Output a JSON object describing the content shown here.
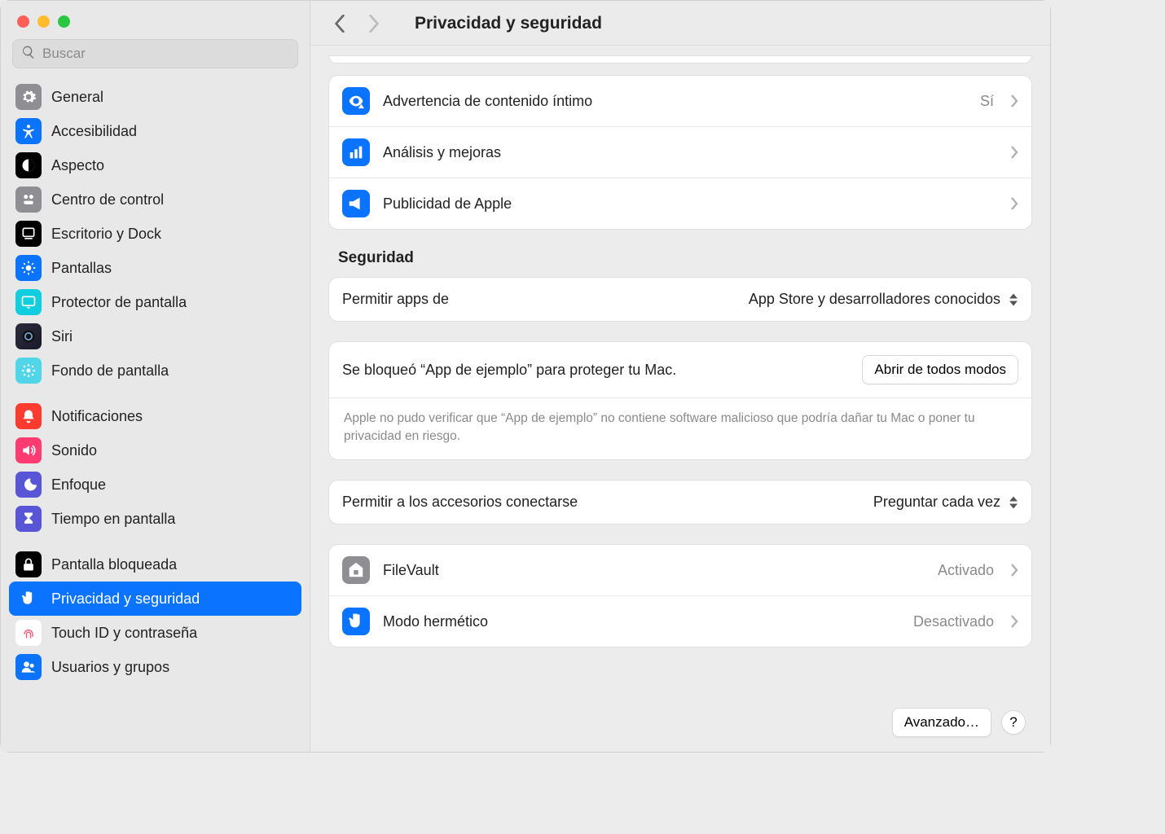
{
  "search": {
    "placeholder": "Buscar"
  },
  "sidebar": {
    "items": [
      {
        "label": "General",
        "icon": "gear",
        "bg": "#8e8e93"
      },
      {
        "label": "Accesibilidad",
        "icon": "access",
        "bg": "#0a73ff"
      },
      {
        "label": "Aspecto",
        "icon": "aspect",
        "bg": "#000000"
      },
      {
        "label": "Centro de control",
        "icon": "control",
        "bg": "#8e8e93"
      },
      {
        "label": "Escritorio y Dock",
        "icon": "dock",
        "bg": "#000000"
      },
      {
        "label": "Pantallas",
        "icon": "displays",
        "bg": "#0a73ff"
      },
      {
        "label": "Protector de pantalla",
        "icon": "screensaver",
        "bg": "#11cde0"
      },
      {
        "label": "Siri",
        "icon": "siri",
        "bg": "grad-siri"
      },
      {
        "label": "Fondo de pantalla",
        "icon": "wallpaper",
        "bg": "#50d6e8"
      },
      {
        "gap": true
      },
      {
        "label": "Notificaciones",
        "icon": "bell",
        "bg": "#ff3b30"
      },
      {
        "label": "Sonido",
        "icon": "sound",
        "bg": "#ff3b72"
      },
      {
        "label": "Enfoque",
        "icon": "moon",
        "bg": "#5856d6"
      },
      {
        "label": "Tiempo en pantalla",
        "icon": "hourglass",
        "bg": "#5856d6"
      },
      {
        "gap": true
      },
      {
        "label": "Pantalla bloqueada",
        "icon": "lockscreen",
        "bg": "#000000"
      },
      {
        "label": "Privacidad y seguridad",
        "icon": "hand",
        "bg": "#0a73ff",
        "selected": true
      },
      {
        "label": "Touch ID y contraseña",
        "icon": "fingerprint",
        "bg": "#ffffff"
      },
      {
        "label": "Usuarios y grupos",
        "icon": "users",
        "bg": "#0a73ff"
      }
    ]
  },
  "header": {
    "title": "Privacidad y seguridad"
  },
  "privacy_rows": [
    {
      "label": "Advertencia de contenido íntimo",
      "value": "Sí",
      "icon": "eye-warn",
      "bg": "#0a73ff"
    },
    {
      "label": "Análisis y mejoras",
      "value": "",
      "icon": "analytics",
      "bg": "#0a73ff"
    },
    {
      "label": "Publicidad de Apple",
      "value": "",
      "icon": "megaphone",
      "bg": "#0a73ff"
    }
  ],
  "security": {
    "header": "Seguridad",
    "allow_apps": {
      "label": "Permitir apps de",
      "value": "App Store y desarrolladores conocidos"
    },
    "blocked": {
      "text": "Se bloqueó “App de ejemplo” para proteger tu Mac.",
      "button": "Abrir de todos modos"
    },
    "explain": "Apple no pudo verificar que “App de ejemplo” no contiene software malicioso que podría dañar tu Mac o poner tu privacidad en riesgo.",
    "accessories": {
      "label": "Permitir a los accesorios conectarse",
      "value": "Preguntar cada vez"
    },
    "filevault": {
      "label": "FileVault",
      "value": "Activado",
      "icon": "house-lock",
      "bg": "#8e8e93"
    },
    "lockdown": {
      "label": "Modo hermético",
      "value": "Desactivado",
      "icon": "hand",
      "bg": "#0a73ff"
    }
  },
  "footer": {
    "advanced": "Avanzado…",
    "help": "?"
  }
}
